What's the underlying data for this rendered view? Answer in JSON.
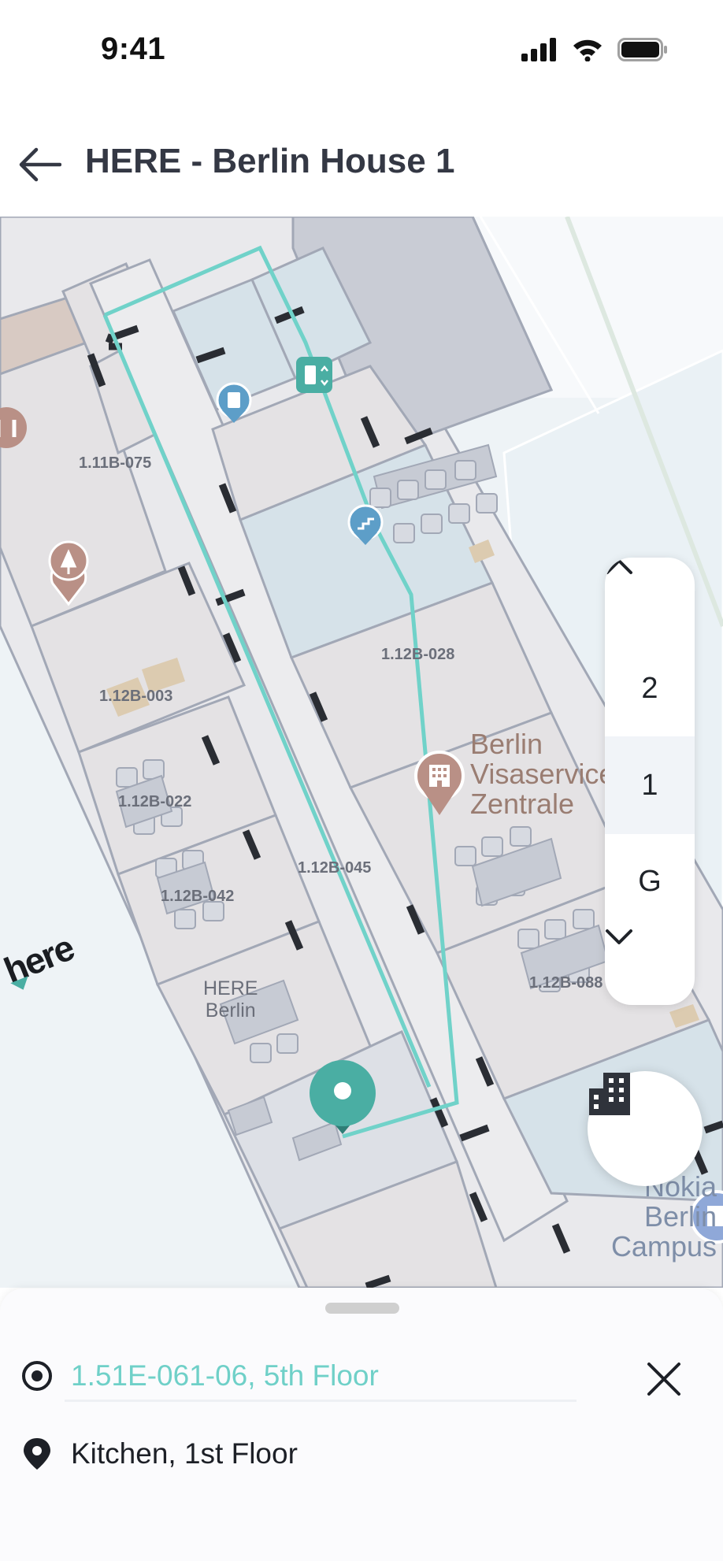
{
  "status_bar": {
    "time": "9:41"
  },
  "header": {
    "title": "HERE - Berlin House 1"
  },
  "map": {
    "rooms": {
      "r1": "1.11B-075",
      "r2": "1.12B-003",
      "r3": "1.12B-022",
      "r4": "1.12B-042",
      "r5": "1.12B-028",
      "r6": "1.12B-045",
      "r7": "1.12B-088",
      "here_line1": "HERE",
      "here_line2": "Berlin"
    },
    "poi_berlin": [
      "Berlin",
      "Visaservice",
      "Zentrale"
    ],
    "poi_nokia": [
      "Nokia",
      "Berlin",
      "Campus"
    ],
    "logo": "here",
    "route_color": "#70d2c9"
  },
  "floor_picker": {
    "floors": [
      "2",
      "1",
      "G"
    ],
    "selected": "1"
  },
  "route": {
    "origin": "1.51E-061-06, 5th Floor",
    "destination": "Kitchen, 1st Floor"
  },
  "icons": {
    "back": "arrow-left-icon",
    "up": "chevron-up-icon",
    "down": "chevron-down-icon",
    "building": "building-icon",
    "close": "close-icon",
    "origin": "target-icon",
    "destination": "location-pin-icon"
  }
}
